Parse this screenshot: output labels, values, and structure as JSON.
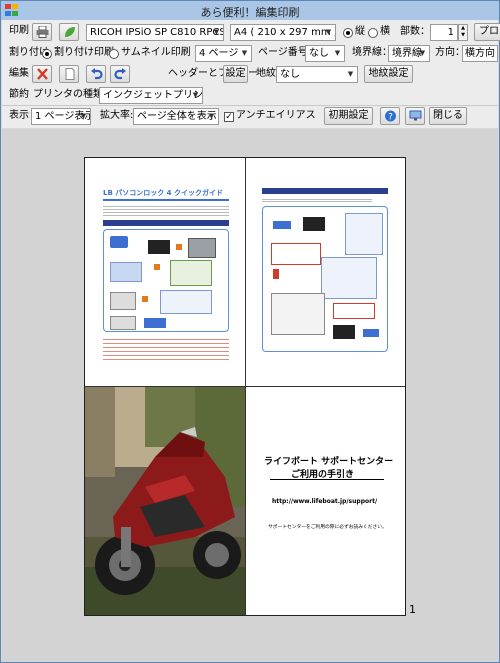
{
  "window": {
    "title": "あら便利！編集印刷"
  },
  "row1": {
    "print_label": "印刷",
    "printer": "RICOH IPSiO SP C810 RPCS",
    "paper": "A4 ( 210 x 297 mm )",
    "orientation_portrait": "縦",
    "orientation_landscape": "横",
    "copies_label": "部数：",
    "copies_value": "1",
    "properties_label": "プロ"
  },
  "row2": {
    "layout_label": "割り付け",
    "nup_print": "割り付け印刷",
    "thumbnail_print": "サムネイル印刷",
    "pages_per_sheet": "4 ページ",
    "page_number_label": "ページ番号：",
    "page_number_value": "なし",
    "border_label": "境界線：",
    "border_value": "境界線",
    "direction_label": "方向：",
    "direction_value": "横方向"
  },
  "row3": {
    "edit_label": "編集",
    "header_footer": "ヘッダーとフッター",
    "settings": "設定",
    "watermark_label": "地紋",
    "watermark_value": "なし",
    "watermark_settings": "地紋設定"
  },
  "row4": {
    "save_label": "節約",
    "printer_type_label": "プリンタの種類：",
    "printer_type_value": "インクジェットプリンタ"
  },
  "row5": {
    "display_label": "表示",
    "display_value": "1 ページ表示",
    "zoom_label": "拡大率:",
    "zoom_value": "ページ全体を表示",
    "antialias_label": "アンチエイリアス",
    "antialias_checked": "✓",
    "init_settings": "初期設定",
    "close": "閉じる"
  },
  "preview": {
    "page_number": "1",
    "doc1_title": "LB パソコンロック 4  クイックガイド",
    "doc4_line1": "ライフボート サポートセンター",
    "doc4_line2": "ご利用の手引き",
    "doc4_url": "http://www.lifeboat.jp/support/",
    "doc4_note": "サポートセンターをご利用の際に必ずお読みください。"
  },
  "colors": {
    "accent": "#3c6fd1",
    "red": "#d23a2a",
    "green": "#4aa83a"
  }
}
